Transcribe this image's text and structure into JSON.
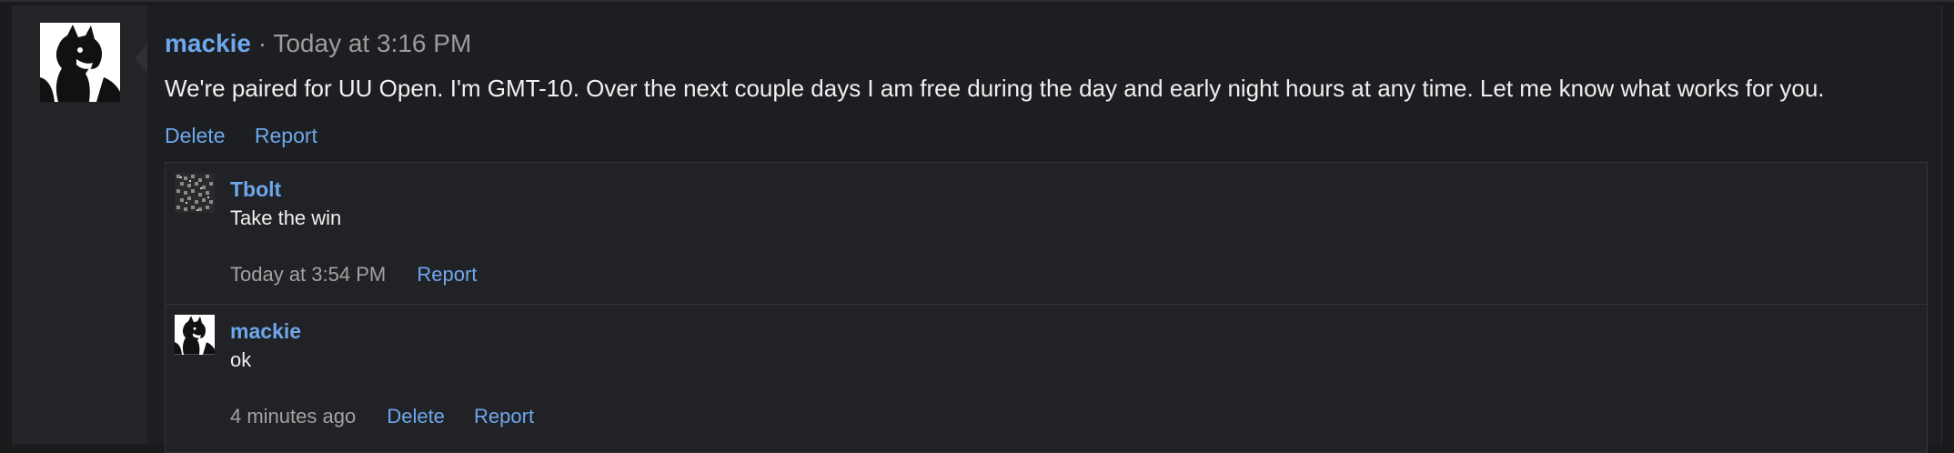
{
  "post": {
    "author": "mackie",
    "separator": "·",
    "timestamp": "Today at 3:16 PM",
    "body": "We're paired for UU Open. I'm GMT-10. Over the next couple days I am free during the day and early night hours at any time. Let me know what works for you.",
    "actions": {
      "delete": "Delete",
      "report": "Report"
    }
  },
  "replies": [
    {
      "author": "Tbolt",
      "text": "Take the win",
      "time": "Today at 3:54 PM",
      "actions": {
        "report": "Report"
      }
    },
    {
      "author": "mackie",
      "text": "ok",
      "time": "4 minutes ago",
      "actions": {
        "delete": "Delete",
        "report": "Report"
      }
    }
  ],
  "colors": {
    "link": "#6ea7ec",
    "background": "#1a1b1d",
    "muted": "#9c9c9c"
  }
}
